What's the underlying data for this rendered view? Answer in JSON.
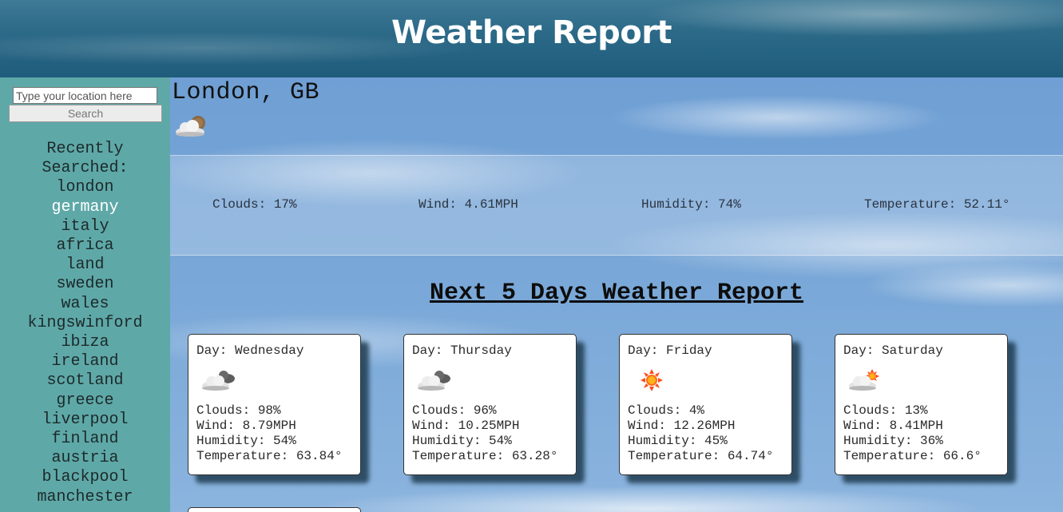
{
  "header": {
    "title": "Weather Report"
  },
  "search": {
    "placeholder": "Type your location here",
    "button_label": "Search"
  },
  "recent": {
    "title": "Recently Searched:",
    "items": [
      "london",
      "germany",
      "italy",
      "africa",
      "land",
      "sweden",
      "wales",
      "kingswinford",
      "ibiza",
      "ireland",
      "scotland",
      "greece",
      "liverpool",
      "finland",
      "austria",
      "blackpool",
      "manchester"
    ],
    "active_index": 1
  },
  "current": {
    "city": "London, GB",
    "icon": "sun-behind-cloud-icon",
    "clouds": "Clouds: 17%",
    "wind": "Wind: 4.61MPH",
    "humidity": "Humidity: 74%",
    "temperature": "Temperature: 52.11°"
  },
  "forecast": {
    "title": "Next 5 Days Weather Report",
    "days": [
      {
        "day": "Day: Wednesday",
        "icon": "cloud-icon",
        "clouds": "Clouds: 98%",
        "wind": "Wind: 8.79MPH",
        "humidity": "Humidity: 54%",
        "temperature": "Temperature: 63.84°"
      },
      {
        "day": "Day: Thursday",
        "icon": "cloud-icon",
        "clouds": "Clouds: 96%",
        "wind": "Wind: 10.25MPH",
        "humidity": "Humidity: 54%",
        "temperature": "Temperature: 63.28°"
      },
      {
        "day": "Day: Friday",
        "icon": "sun-icon",
        "clouds": "Clouds: 4%",
        "wind": "Wind: 12.26MPH",
        "humidity": "Humidity: 45%",
        "temperature": "Temperature: 64.74°"
      },
      {
        "day": "Day: Saturday",
        "icon": "sun-behind-cloud-icon",
        "clouds": "Clouds: 13%",
        "wind": "Wind: 8.41MPH",
        "humidity": "Humidity: 36%",
        "temperature": "Temperature: 66.6°"
      }
    ]
  },
  "colors": {
    "header": "#1f5c7c",
    "sidebar": "#5fa8a8",
    "sky": "#7aa8d8",
    "active_item": "#ffffff"
  }
}
